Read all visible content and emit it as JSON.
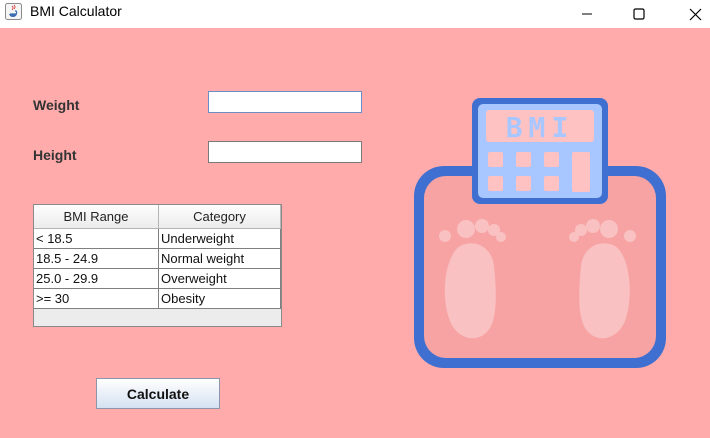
{
  "window": {
    "title": "BMI Calculator"
  },
  "form": {
    "weight_label": "Weight",
    "weight_value": "",
    "height_label": "Height",
    "height_value": ""
  },
  "table": {
    "headers": [
      "BMI Range",
      "Category"
    ],
    "rows": [
      [
        "< 18.5",
        "Underweight"
      ],
      [
        "18.5 - 24.9",
        "Normal weight"
      ],
      [
        "25.0 - 29.9",
        "Overweight"
      ],
      [
        ">= 30",
        "Obesity"
      ]
    ]
  },
  "actions": {
    "calculate_label": "Calculate"
  },
  "illustration": {
    "scale_text": "BMI",
    "icon": "bathroom-scale-icon"
  },
  "colors": {
    "background": "#ffabab",
    "scale_blue": "#3f6fd0",
    "display_blue": "#a8c6ff"
  }
}
